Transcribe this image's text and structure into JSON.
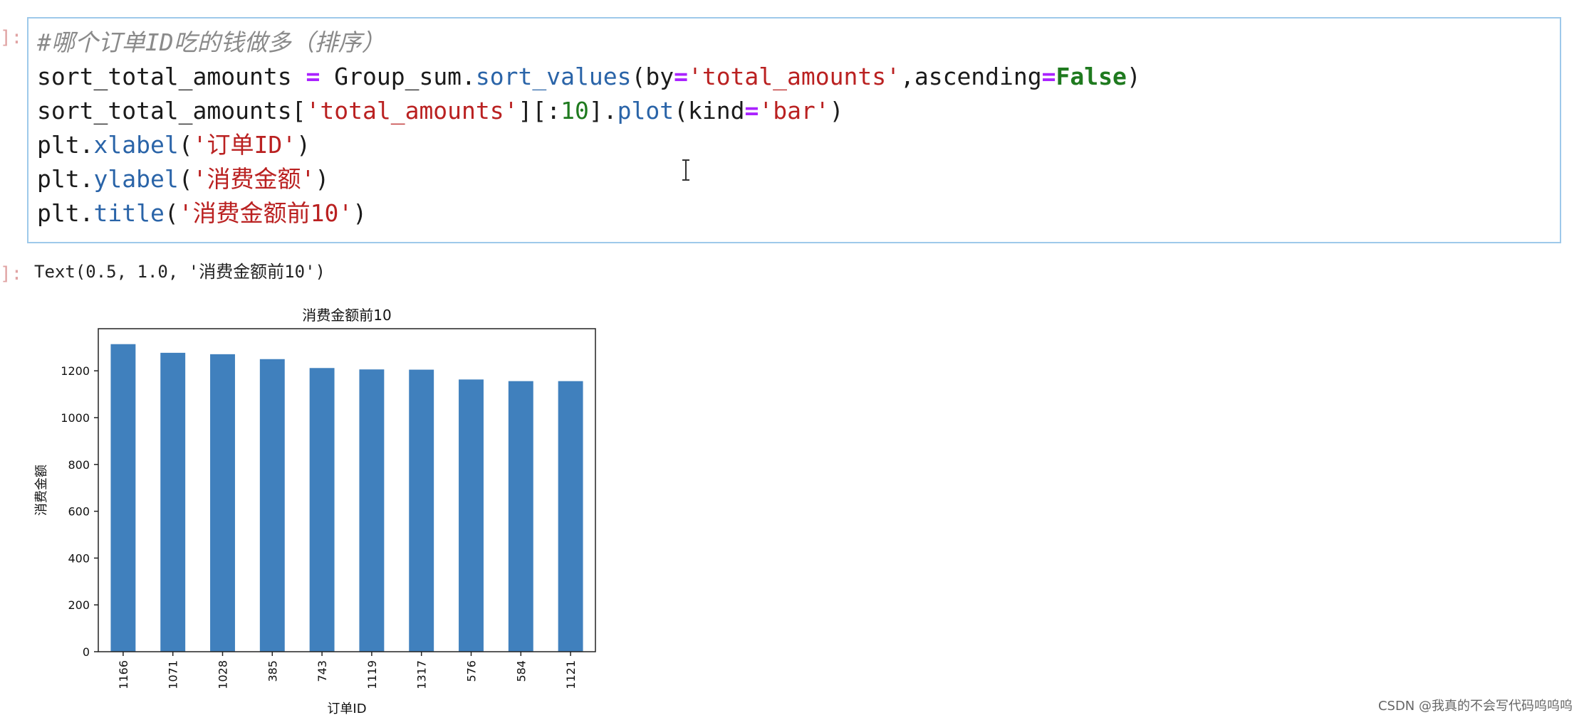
{
  "notebook": {
    "input_prompt": "]:",
    "output_prompt": "]:",
    "code_lines": [
      [
        {
          "t": "#哪个订单ID吃的钱做多（排序）",
          "c": "cm"
        }
      ],
      [
        {
          "t": "sort_total_amounts ",
          "c": ""
        },
        {
          "t": "=",
          "c": "op"
        },
        {
          "t": " Group_sum.",
          "c": ""
        },
        {
          "t": "sort_values",
          "c": "fn"
        },
        {
          "t": "(by",
          "c": ""
        },
        {
          "t": "=",
          "c": "op"
        },
        {
          "t": "'total_amounts'",
          "c": "st"
        },
        {
          "t": ",ascending",
          "c": ""
        },
        {
          "t": "=",
          "c": "op"
        },
        {
          "t": "False",
          "c": "kw"
        },
        {
          "t": ")",
          "c": ""
        }
      ],
      [
        {
          "t": "sort_total_amounts[",
          "c": ""
        },
        {
          "t": "'total_amounts'",
          "c": "st"
        },
        {
          "t": "][:",
          "c": ""
        },
        {
          "t": "10",
          "c": "nu"
        },
        {
          "t": "].",
          "c": ""
        },
        {
          "t": "plot",
          "c": "fn"
        },
        {
          "t": "(kind",
          "c": ""
        },
        {
          "t": "=",
          "c": "op"
        },
        {
          "t": "'bar'",
          "c": "st"
        },
        {
          "t": ")",
          "c": ""
        }
      ],
      [
        {
          "t": "plt.",
          "c": ""
        },
        {
          "t": "xlabel",
          "c": "fn"
        },
        {
          "t": "(",
          "c": ""
        },
        {
          "t": "'订单ID'",
          "c": "st"
        },
        {
          "t": ")",
          "c": ""
        }
      ],
      [
        {
          "t": "plt.",
          "c": ""
        },
        {
          "t": "ylabel",
          "c": "fn"
        },
        {
          "t": "(",
          "c": ""
        },
        {
          "t": "'消费金额'",
          "c": "st"
        },
        {
          "t": ")",
          "c": ""
        }
      ],
      [
        {
          "t": "plt.",
          "c": ""
        },
        {
          "t": "title",
          "c": "fn"
        },
        {
          "t": "(",
          "c": ""
        },
        {
          "t": "'消费金额前10'",
          "c": "st"
        },
        {
          "t": ")",
          "c": ""
        }
      ]
    ],
    "output_text": "Text(0.5, 1.0, '消费金额前10')"
  },
  "chart_data": {
    "type": "bar",
    "title": "消费金额前10",
    "xlabel": "订单ID",
    "ylabel": "消费金额",
    "categories": [
      "1166",
      "1071",
      "1028",
      "385",
      "743",
      "1119",
      "1317",
      "576",
      "584",
      "1121"
    ],
    "values": [
      1314,
      1277,
      1271,
      1250,
      1212,
      1206,
      1205,
      1163,
      1156,
      1156
    ],
    "ylim": [
      0,
      1380
    ],
    "yticks": [
      0,
      200,
      400,
      600,
      800,
      1000,
      1200
    ],
    "bar_color": "#4080bd"
  },
  "watermark": "CSDN @我真的不会写代码呜呜呜"
}
